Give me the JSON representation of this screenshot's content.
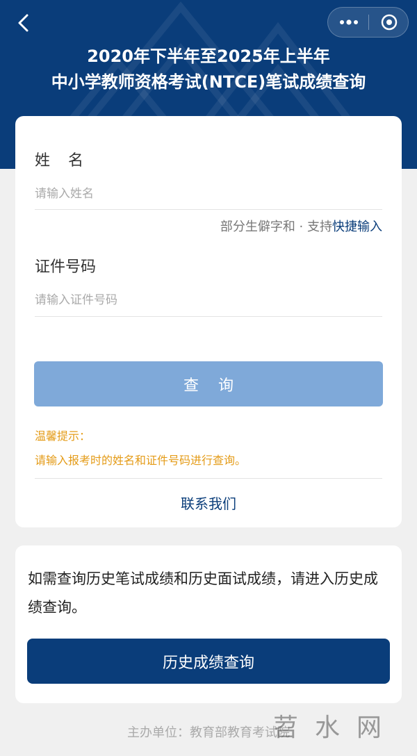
{
  "header": {
    "title_line1": "2020年下半年至2025年上半年",
    "title_line2": "中小学教师资格考试(NTCE)笔试成绩查询",
    "back_icon": "chevron-left-icon",
    "menu_icon": "more-dots-icon",
    "close_icon": "target-circle-icon",
    "color": "#0a3d7a"
  },
  "form": {
    "name_label": "姓名",
    "name_placeholder": "请输入姓名",
    "quick_hint_prefix": "部分生僻字和 · 支持",
    "quick_hint_link": "快捷输入",
    "id_label": "证件号码",
    "id_placeholder": "请输入证件号码",
    "query_button": "查询",
    "query_button_color": "#7fa9d9",
    "tip_title": "温馨提示：",
    "tip_text": "请输入报考时的姓名和证件号码进行查询。",
    "tip_color": "#e49b17",
    "contact_link": "联系我们"
  },
  "history": {
    "text": "如需查询历史笔试成绩和历史面试成绩，请进入历史成绩查询。",
    "button": "历史成绩查询"
  },
  "footer": {
    "organizer": "主办单位：教育部教育考试院"
  },
  "watermark": {
    "text": "苕水网"
  }
}
